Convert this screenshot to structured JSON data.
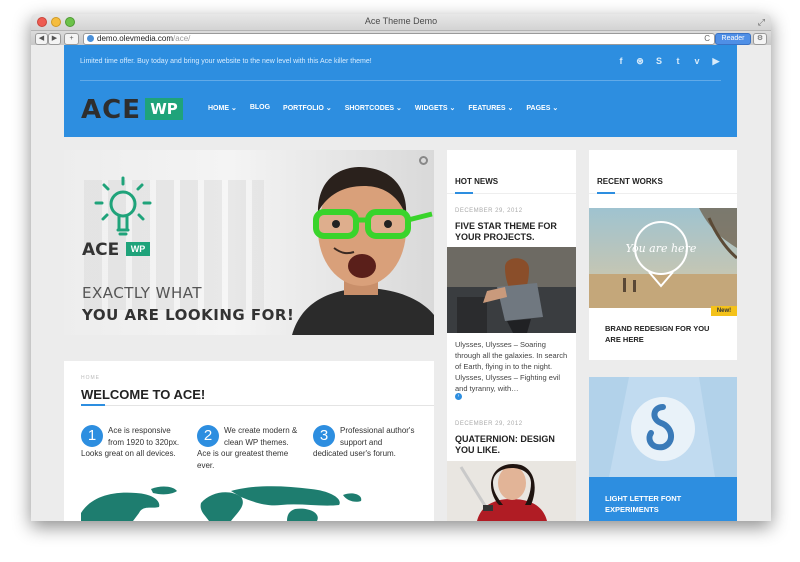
{
  "browser": {
    "window_title": "Ace Theme Demo",
    "url_host": "demo.olevmedia.com",
    "url_path": "/ace/",
    "reader_label": "Reader",
    "back_glyph": "◀",
    "forward_glyph": "▶",
    "add_glyph": "+",
    "reload_glyph": "C",
    "settings_glyph": "⚙",
    "fullscreen_glyph": "⤢"
  },
  "header": {
    "promo": "Limited time offer. Buy today and bring your website to the new level with this Ace killer theme!",
    "social_icons": [
      "facebook-icon",
      "dribbble-icon",
      "skype-icon",
      "twitter-icon",
      "vimeo-icon",
      "youtube-icon"
    ],
    "social_glyphs": [
      "f",
      "⊛",
      "S",
      "t",
      "v",
      "▶"
    ],
    "logo_text": "ACE",
    "logo_badge": "WP",
    "nav": [
      "HOME ⌄",
      "BLOG",
      "PORTFOLIO ⌄",
      "SHORTCODES ⌄",
      "WIDGETS ⌄",
      "FEATURES ⌄",
      "PAGES ⌄"
    ]
  },
  "hero": {
    "logo_text": "ACE",
    "logo_badge": "WP",
    "line1": "EXACTLY WHAT",
    "line2": "YOU ARE LOOKING FOR!"
  },
  "welcome": {
    "kicker": "HOME",
    "title": "WELCOME TO ACE!",
    "features": [
      {
        "num": "1",
        "text": "Ace is responsive from 1920 to 320px. Looks great on all devices."
      },
      {
        "num": "2",
        "text": "We create modern & clean WP themes. Ace is our greatest theme ever."
      },
      {
        "num": "3",
        "text": "Professional author's support and dedicated user's forum."
      }
    ]
  },
  "hot_news": {
    "title": "HOT NEWS",
    "items": [
      {
        "date": "DECEMBER 29, 2012",
        "headline": "FIVE STAR THEME FOR YOUR PROJECTS.",
        "excerpt": "Ulysses, Ulysses – Soaring through all the galaxies. In search of Earth, flying in to the night. Ulysses, Ulysses – Fighting evil and tyranny, with…"
      },
      {
        "date": "DECEMBER 29, 2012",
        "headline": "QUATERNION: DESIGN YOU LIKE."
      }
    ],
    "more_glyph": "›"
  },
  "recent_works": {
    "title": "RECENT WORKS",
    "badge": "New!",
    "items": [
      {
        "title": "BRAND REDESIGN FOR YOU ARE HERE",
        "art_text": "You are here"
      },
      {
        "title": "LIGHT LETTER FONT EXPERIMENTS"
      }
    ]
  },
  "colors": {
    "brand_blue": "#2d8ee0",
    "brand_green": "#1fa37a",
    "badge_yellow": "#f4c21a",
    "map_teal": "#1e7d6f"
  }
}
